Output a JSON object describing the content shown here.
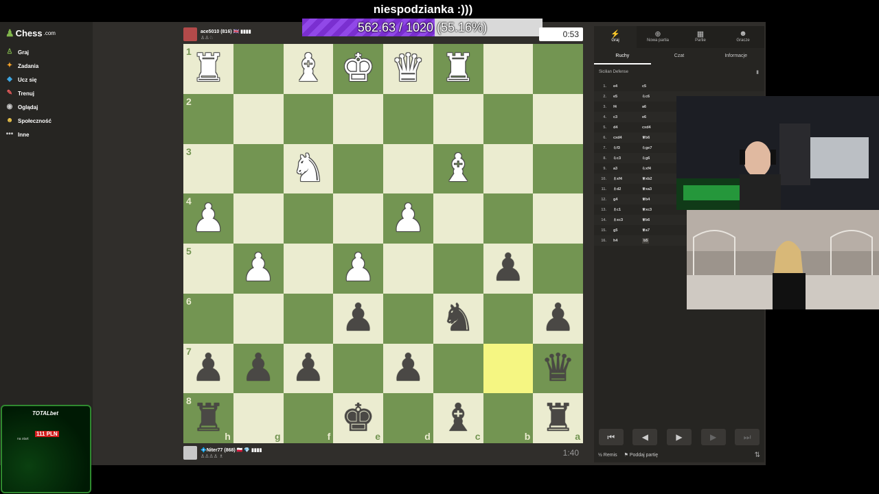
{
  "stream_overlay": {
    "title": "niespodzianka :)))",
    "progress_text": "562.63 / 1020 (55.16%)",
    "progress_fraction": 0.5516
  },
  "sidebar": {
    "logo_text": "Chess",
    "logo_suffix": ".com",
    "items": [
      {
        "label": "Graj",
        "icon": "play-pawn-icon",
        "color": "#81b64c",
        "glyph": "♙"
      },
      {
        "label": "Zadania",
        "icon": "puzzle-icon",
        "color": "#f7a42b",
        "glyph": "✦"
      },
      {
        "label": "Ucz się",
        "icon": "learn-icon",
        "color": "#3da5e0",
        "glyph": "◆"
      },
      {
        "label": "Trenuj",
        "icon": "train-icon",
        "color": "#e65a5a",
        "glyph": "✎"
      },
      {
        "label": "Oglądaj",
        "icon": "watch-icon",
        "color": "#cccccc",
        "glyph": "◉"
      },
      {
        "label": "Społeczność",
        "icon": "community-icon",
        "color": "#f2c94c",
        "glyph": "☻"
      },
      {
        "label": "Inne",
        "icon": "more-icon",
        "color": "#cccccc",
        "glyph": "•••"
      }
    ]
  },
  "top_player": {
    "name": "ace5010 (816) 🇬🇧 ▮▮▮▮",
    "sub": "♙♙♘",
    "clock": "0:53"
  },
  "bottom_player": {
    "name": "💠Niter77 (868) 🇵🇱 💎 ▮▮▮▮",
    "sub": "♙♙♙♙ ♗",
    "clock": "1:40"
  },
  "board": {
    "ranks": [
      "1",
      "2",
      "3",
      "4",
      "5",
      "6",
      "7",
      "8"
    ],
    "files": [
      "h",
      "g",
      "f",
      "e",
      "d",
      "c",
      "b",
      "a"
    ],
    "rows": [
      [
        "wR",
        "",
        "wB",
        "wK",
        "wQ",
        "wR",
        "",
        ""
      ],
      [
        "",
        "",
        "",
        "",
        "",
        "",
        "",
        ""
      ],
      [
        "",
        "",
        "wN",
        "",
        "",
        "wB",
        "",
        ""
      ],
      [
        "wP",
        "",
        "",
        "",
        "wP",
        "",
        "",
        ""
      ],
      [
        "",
        "wP",
        "",
        "wP",
        "",
        "",
        "bP",
        ""
      ],
      [
        "",
        "",
        "",
        "bP",
        "",
        "bN",
        "",
        "bP"
      ],
      [
        "bP",
        "bP",
        "bP",
        "",
        "bP",
        "",
        "",
        "bQ"
      ],
      [
        "bR",
        "",
        "",
        "bK",
        "",
        "bB",
        "",
        "bR"
      ]
    ],
    "highlight": [
      [
        6,
        6
      ]
    ]
  },
  "panel": {
    "tabs": [
      {
        "label": "Graj",
        "icon": "lightning-icon",
        "glyph": "⚡"
      },
      {
        "label": "Nowa partia",
        "icon": "plus-icon",
        "glyph": "⊕"
      },
      {
        "label": "Partie",
        "icon": "board-icon",
        "glyph": "▦"
      },
      {
        "label": "Gracze",
        "icon": "players-icon",
        "glyph": "☻"
      }
    ],
    "subtabs": [
      "Ruchy",
      "Czat",
      "Informacje"
    ],
    "opening": "Sicilian Defense",
    "moves": [
      [
        "1.",
        "e4",
        "c5"
      ],
      [
        "2.",
        "e5",
        "♘c6"
      ],
      [
        "3.",
        "f4",
        "a6"
      ],
      [
        "4.",
        "c3",
        "e6"
      ],
      [
        "5.",
        "d4",
        "cxd4"
      ],
      [
        "6.",
        "cxd4",
        "♕b6"
      ],
      [
        "7.",
        "♘f3",
        "♘ge7"
      ],
      [
        "8.",
        "♘c3",
        "♘g6"
      ],
      [
        "9.",
        "a3",
        "♘xf4"
      ],
      [
        "10.",
        "♗xf4",
        "♕xb2"
      ],
      [
        "11.",
        "♗d2",
        "♕xa3"
      ],
      [
        "12.",
        "g4",
        "♕b4"
      ],
      [
        "13.",
        "♗c1",
        "♕xc3"
      ],
      [
        "14.",
        "♗xc3",
        "♕b6"
      ],
      [
        "15.",
        "g5",
        "♕a7"
      ],
      [
        "16.",
        "h4",
        "b5"
      ]
    ],
    "controls": [
      "⏮",
      "◀",
      "▶",
      "▶",
      "⏭"
    ],
    "draw_label": "Remis",
    "draw_prefix": "½",
    "resign_label": "Poddaj partię",
    "resign_icon": "flag-icon",
    "flip_icon": "flip-board-icon"
  },
  "bet_widget": {
    "brand": "TOTALbet",
    "badge": "111 PLN",
    "sub": "na start"
  }
}
